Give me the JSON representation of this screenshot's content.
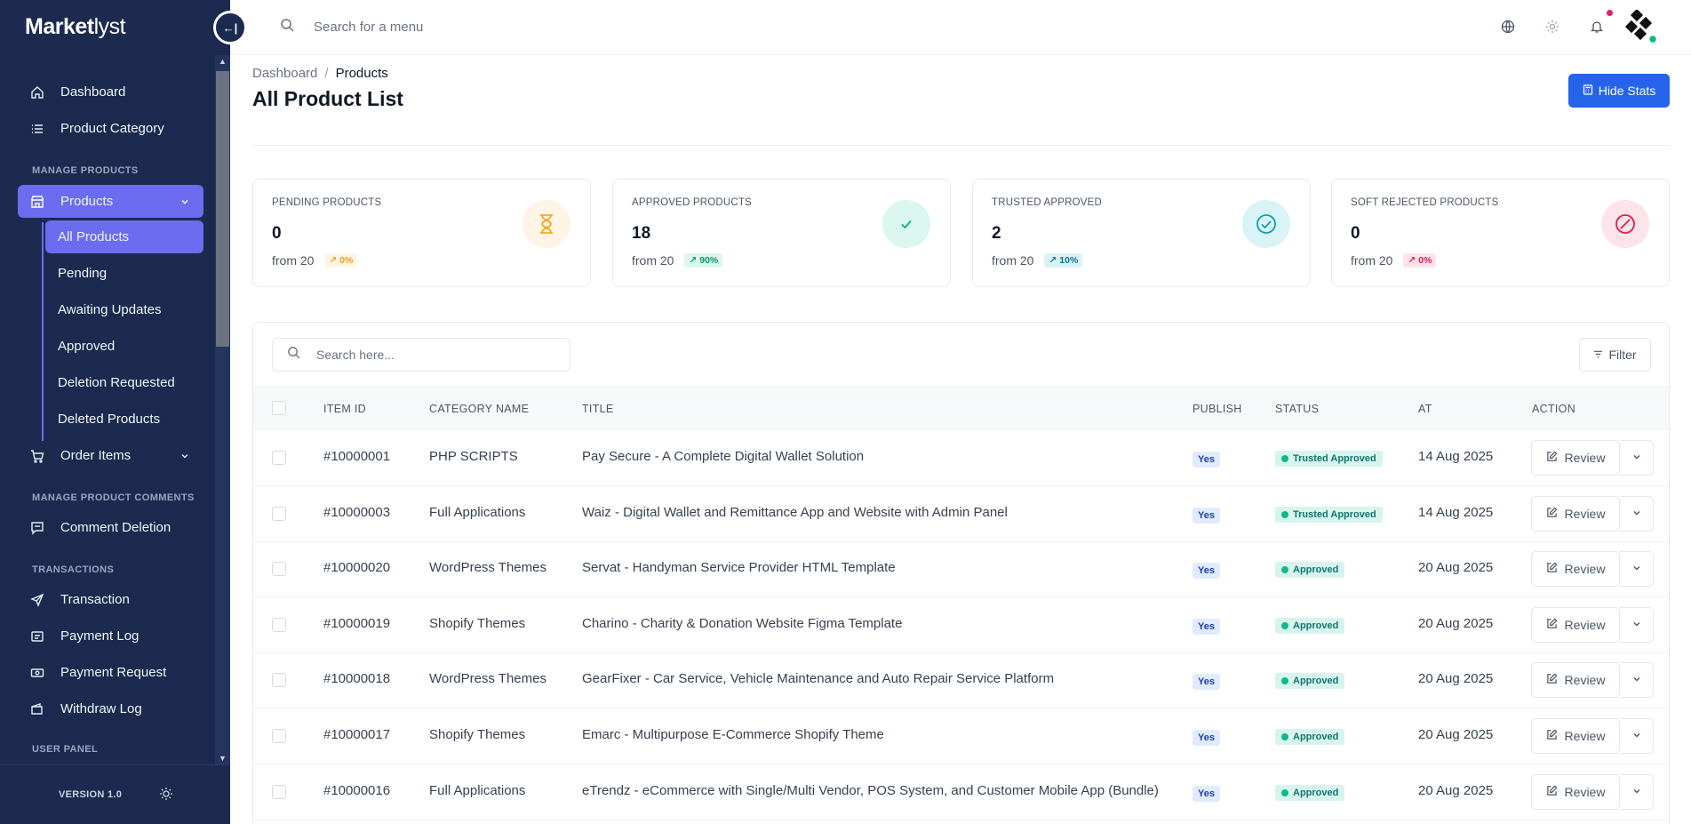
{
  "brand": {
    "name_bold": "Market",
    "name_light": "lyst"
  },
  "sidebar": {
    "items_top": [
      {
        "label": "Dashboard",
        "icon": "home-icon"
      },
      {
        "label": "Product Category",
        "icon": "list-icon"
      }
    ],
    "section_products": "MANAGE PRODUCTS",
    "products": {
      "label": "Products",
      "icon": "store-icon"
    },
    "sub_items": [
      {
        "label": "All Products"
      },
      {
        "label": "Pending"
      },
      {
        "label": "Awaiting Updates"
      },
      {
        "label": "Approved"
      },
      {
        "label": "Deletion Requested"
      },
      {
        "label": "Deleted Products"
      }
    ],
    "order_items": {
      "label": "Order Items",
      "icon": "cart-icon"
    },
    "section_comments": "MANAGE PRODUCT COMMENTS",
    "comment_deletion": {
      "label": "Comment Deletion",
      "icon": "comment-icon"
    },
    "section_transactions": "TRANSACTIONS",
    "transactions": [
      {
        "label": "Transaction",
        "icon": "send-icon"
      },
      {
        "label": "Payment Log",
        "icon": "receipt-icon"
      },
      {
        "label": "Payment Request",
        "icon": "money-icon"
      },
      {
        "label": "Withdraw Log",
        "icon": "wallet-icon"
      }
    ],
    "section_user": "USER PANEL",
    "version": "VERSION 1.0"
  },
  "topbar": {
    "search_placeholder": "Search for a menu"
  },
  "breadcrumb": {
    "root": "Dashboard",
    "separator": "/",
    "current": "Products"
  },
  "page_title": "All Product List",
  "hide_stats_label": "Hide Stats",
  "stats": [
    {
      "label": "PENDING PRODUCTS",
      "value": "0",
      "from": "from 20",
      "pct": "0%",
      "icon": "hourglass-icon",
      "color": "#f59e0b",
      "bg": "#fff4e6",
      "pct_bg": "#fff4e6"
    },
    {
      "label": "APPROVED PRODUCTS",
      "value": "18",
      "from": "from 20",
      "pct": "90%",
      "icon": "check-icon",
      "color": "#10b981",
      "bg": "#dcf7ef",
      "pct_bg": "#dcf7ef"
    },
    {
      "label": "TRUSTED APPROVED",
      "value": "2",
      "from": "from 20",
      "pct": "10%",
      "icon": "check-circle-icon",
      "color": "#0e9fb5",
      "bg": "#d9f3f6",
      "pct_bg": "#d9f3f6"
    },
    {
      "label": "SOFT REJECTED PRODUCTS",
      "value": "0",
      "from": "from 20",
      "pct": "0%",
      "icon": "ban-icon",
      "color": "#e11d48",
      "bg": "#fde4ea",
      "pct_bg": "#fde4ea"
    }
  ],
  "table": {
    "search_placeholder": "Search here...",
    "filter_label": "Filter",
    "columns": [
      "ITEM ID",
      "CATEGORY NAME",
      "TITLE",
      "PUBLISH",
      "STATUS",
      "AT",
      "ACTION"
    ],
    "review_label": "Review",
    "rows": [
      {
        "id": "#10000001",
        "category": "PHP SCRIPTS",
        "title": "Pay Secure - A Complete Digital Wallet Solution",
        "publish": "Yes",
        "status": "Trusted Approved",
        "at": "14 Aug 2025"
      },
      {
        "id": "#10000003",
        "category": "Full Applications",
        "title": "Waiz - Digital Wallet and Remittance App and Website with Admin Panel",
        "publish": "Yes",
        "status": "Trusted Approved",
        "at": "14 Aug 2025"
      },
      {
        "id": "#10000020",
        "category": "WordPress Themes",
        "title": "Servat - Handyman Service Provider HTML Template",
        "publish": "Yes",
        "status": "Approved",
        "at": "20 Aug 2025"
      },
      {
        "id": "#10000019",
        "category": "Shopify Themes",
        "title": "Charino - Charity & Donation Website Figma Template",
        "publish": "Yes",
        "status": "Approved",
        "at": "20 Aug 2025"
      },
      {
        "id": "#10000018",
        "category": "WordPress Themes",
        "title": "GearFixer - Car Service, Vehicle Maintenance and Auto Repair Service Platform",
        "publish": "Yes",
        "status": "Approved",
        "at": "20 Aug 2025"
      },
      {
        "id": "#10000017",
        "category": "Shopify Themes",
        "title": "Emarc - Multipurpose E-Commerce Shopify Theme",
        "publish": "Yes",
        "status": "Approved",
        "at": "20 Aug 2025"
      },
      {
        "id": "#10000016",
        "category": "Full Applications",
        "title": "eTrendz - eCommerce with Single/Multi Vendor, POS System, and Customer Mobile App (Bundle)",
        "publish": "Yes",
        "status": "Approved",
        "at": "20 Aug 2025"
      }
    ]
  }
}
